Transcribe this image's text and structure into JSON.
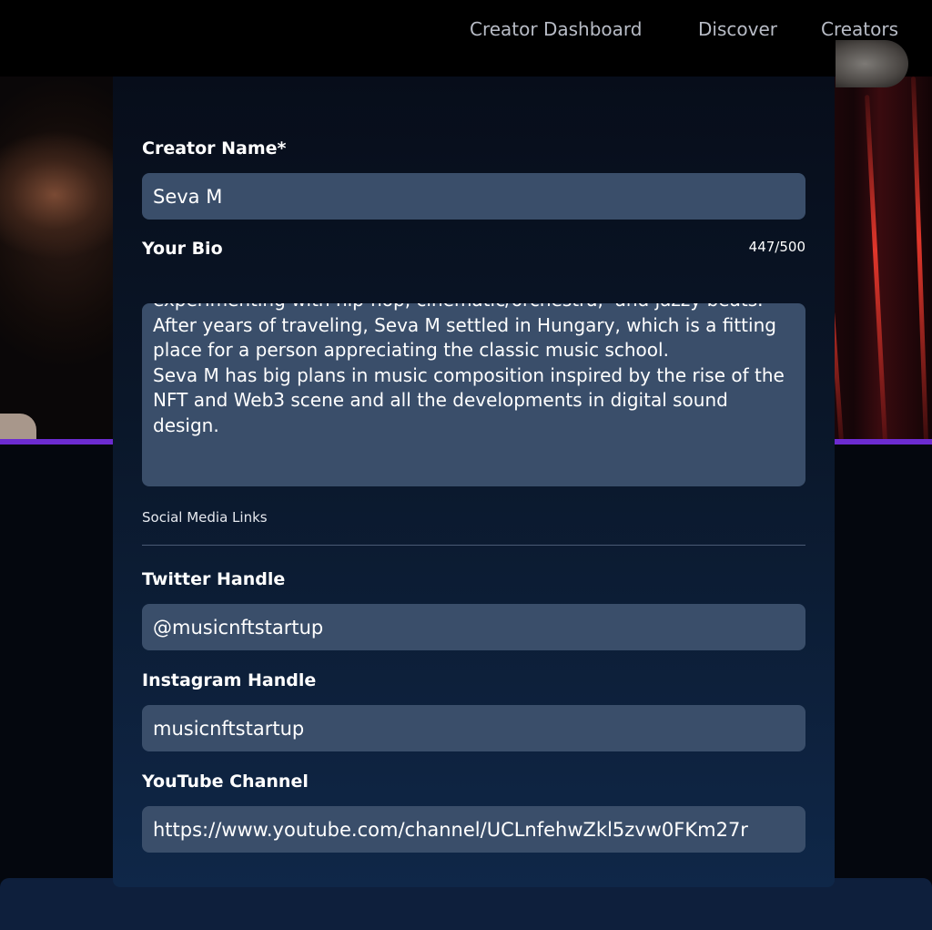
{
  "nav": {
    "links": [
      "Creator Dashboard",
      "Discover",
      "Creators"
    ]
  },
  "colors": {
    "accent_purple": "#6c2bd0",
    "field_bg": "#3a4e6a",
    "card_top": "#070d1a",
    "card_bottom": "#0f2748",
    "nav_text": "#b8bcc6"
  },
  "form": {
    "creator_name": {
      "label": "Creator Name*",
      "value": "Seva M"
    },
    "bio": {
      "label": "Your Bio",
      "counter": "447/500",
      "visible_text": "experimenting with hip-hop, cinematic/orchestra,  and jazzy beats. After years of traveling, Seva M settled in Hungary, which is a fitting place for a person appreciating the classic music school.\nSeva M has big plans in music composition inspired by the rise of the NFT and Web3 scene and all the developments in digital sound design."
    },
    "social_section_label": "Social Media Links",
    "twitter": {
      "label": "Twitter Handle",
      "value": "@musicnftstartup"
    },
    "instagram": {
      "label": "Instagram Handle",
      "value": "musicnftstartup"
    },
    "youtube": {
      "label": "YouTube Channel",
      "value": "https://www.youtube.com/channel/UCLnfehwZkl5zvw0FKm27r"
    }
  }
}
